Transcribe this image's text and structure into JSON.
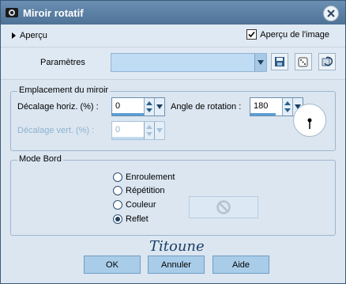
{
  "window": {
    "title": "Miroir rotatif"
  },
  "toolbar": {
    "apercu_label": "Aperçu",
    "preview_image_label": "Aperçu de l'image",
    "preview_checked": true
  },
  "parameters": {
    "label": "Paramètres",
    "preset_value": ""
  },
  "mirror": {
    "legend": "Emplacement du miroir",
    "h_offset_label": "Décalage horiz. (%) :",
    "h_offset_value": "0",
    "v_offset_label": "Décalage vert. (%) :",
    "v_offset_value": "0",
    "rotation_label": "Angle de rotation :",
    "rotation_value": "180"
  },
  "edge_mode": {
    "legend": "Mode Bord",
    "options": [
      "Enroulement",
      "Répétition",
      "Couleur",
      "Reflet"
    ],
    "selected": "Reflet"
  },
  "signature": "Titoune",
  "buttons": {
    "ok": "OK",
    "cancel": "Annuler",
    "help": "Aide"
  },
  "colors": {
    "title_bar": "#5b7fa3",
    "dialog_bg": "#dbe6f1",
    "button": "#a9cde9"
  }
}
